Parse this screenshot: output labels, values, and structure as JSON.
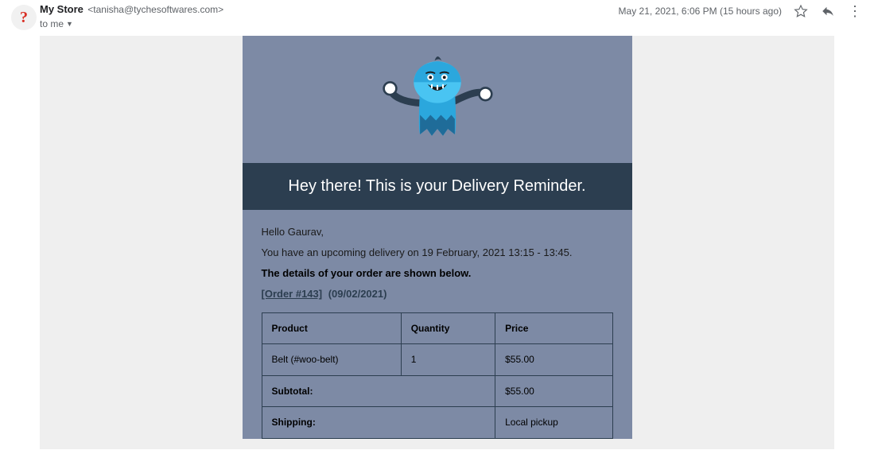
{
  "header": {
    "avatar_char": "?",
    "from_name": "My Store",
    "from_email": "<tanisha@tychesoftwares.com>",
    "to_line": "to me",
    "timestamp": "May 21, 2021, 6:06 PM (15 hours ago)"
  },
  "email": {
    "banner": "Hey there! This is your Delivery Reminder.",
    "greeting": "Hello Gaurav,",
    "schedule_line": "You have an upcoming delivery on 19 February, 2021 13:15 - 13:45.",
    "details_intro": "The details of your order are shown below.",
    "order_link": "[Order #143]",
    "order_date": "(09/02/2021)",
    "columns": {
      "product": "Product",
      "quantity": "Quantity",
      "price": "Price"
    },
    "items": [
      {
        "product": "Belt (#woo-belt)",
        "quantity": "1",
        "price": "$55.00"
      }
    ],
    "subtotal_label": "Subtotal:",
    "subtotal_value": "$55.00",
    "shipping_label": "Shipping:",
    "shipping_value": "Local pickup"
  }
}
